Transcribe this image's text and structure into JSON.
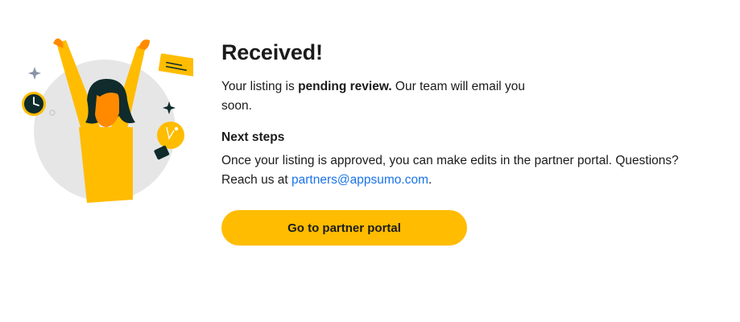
{
  "header": {
    "title": "Received!"
  },
  "status": {
    "prefix": "Your listing is ",
    "emphasis": "pending review.",
    "suffix": " Our team will email you soon."
  },
  "next_steps": {
    "heading": "Next steps",
    "body_prefix": "Once your listing is approved, you can make edits in the partner portal. Questions? Reach us at ",
    "email": "partners@appsumo.com",
    "body_suffix": "."
  },
  "cta": {
    "label": "Go to partner portal"
  },
  "illustration": {
    "name": "celebrating-person-illustration",
    "icons": [
      "sparkle-icon",
      "clock-icon",
      "note-card-icon",
      "lightbulb-icon"
    ]
  },
  "colors": {
    "accent": "#ffbc00",
    "link": "#1a73e8",
    "text": "#1b1b1b",
    "circle": "#e6e6e6",
    "skin": "#ff8a00",
    "dark": "#0f2b2b"
  }
}
